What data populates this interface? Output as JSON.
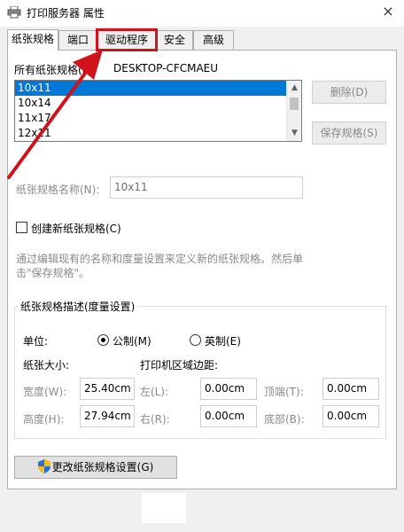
{
  "window": {
    "title": "打印服务器 属性",
    "close_glyph": "×"
  },
  "tabs": [
    {
      "label": "纸张规格",
      "active": true
    },
    {
      "label": "端口"
    },
    {
      "label": "驱动程序",
      "highlighted": true
    },
    {
      "label": "安全"
    },
    {
      "label": "高级"
    }
  ],
  "forms": {
    "all_forms_label": "所有纸张规格(F):",
    "server_name": "DESKTOP-CFCMAEU",
    "items": [
      "10x11",
      "10x14",
      "11x17",
      "12x11"
    ],
    "selected": "10x11"
  },
  "buttons": {
    "delete": "删除(D)",
    "save_form": "保存规格(S)",
    "change_settings": "更改纸张规格设置(G)"
  },
  "form_name": {
    "label": "纸张规格名称(N):",
    "value": "10x11"
  },
  "create_new": {
    "label": "创建新纸张规格(C)",
    "checked": false
  },
  "help_text": {
    "line1": "通过编辑现有的名称和度量设置来定义新的纸张规格。然后单",
    "line2": "击\"保存规格\"。"
  },
  "description": {
    "group_title": "纸张规格描述(度量设置)",
    "units_label": "单位:",
    "metric": "公制(M)",
    "english": "英制(E)",
    "units_selected": "metric",
    "paper_size_label": "纸张大小:",
    "margins_label": "打印机区域边距:",
    "width": {
      "label": "宽度(W):",
      "value": "25.40cm"
    },
    "height": {
      "label": "高度(H):",
      "value": "27.94cm"
    },
    "left": {
      "label": "左(L):",
      "value": "0.00cm"
    },
    "right": {
      "label": "右(R):",
      "value": "0.00cm"
    },
    "top": {
      "label": "顶端(T):",
      "value": "0.00cm"
    },
    "bottom": {
      "label": "底部(B):",
      "value": "0.00cm"
    }
  },
  "colors": {
    "selection": "#0078d7",
    "annotation": "#d0121b"
  }
}
